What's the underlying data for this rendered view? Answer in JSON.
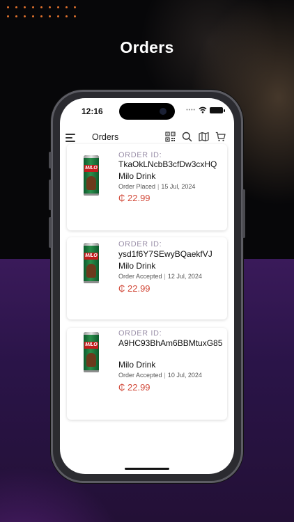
{
  "page": {
    "title": "Orders"
  },
  "status_bar": {
    "time": "12:16"
  },
  "app_bar": {
    "title": "Orders",
    "icons": [
      "menu-icon",
      "qr-code-icon",
      "search-icon",
      "map-icon",
      "cart-icon"
    ]
  },
  "colors": {
    "price": "#d24a3a",
    "accent_dots": "#e0722e",
    "label": "#9a8fa8"
  },
  "orders": [
    {
      "label": "ORDER ID:",
      "id": "TkaOkLNcbB3cfDw3cxHQ",
      "product": "Milo Drink",
      "status": "Order Placed",
      "date": "15 Jul, 2024",
      "price": "₵ 22.99",
      "image_icon": "milo-can-icon"
    },
    {
      "label": "ORDER ID:",
      "id": "ysd1f6Y7SEwyBQaekfVJ",
      "product": "Milo Drink",
      "status": "Order Accepted",
      "date": "12 Jul, 2024",
      "price": "₵ 22.99",
      "image_icon": "milo-can-icon"
    },
    {
      "label": "ORDER ID:",
      "id": "A9HC93BhAm6BBMtuxG85",
      "product": "Milo Drink",
      "status": "Order Accepted",
      "date": "10 Jul, 2024",
      "price": "₵ 22.99",
      "image_icon": "milo-can-icon"
    }
  ]
}
